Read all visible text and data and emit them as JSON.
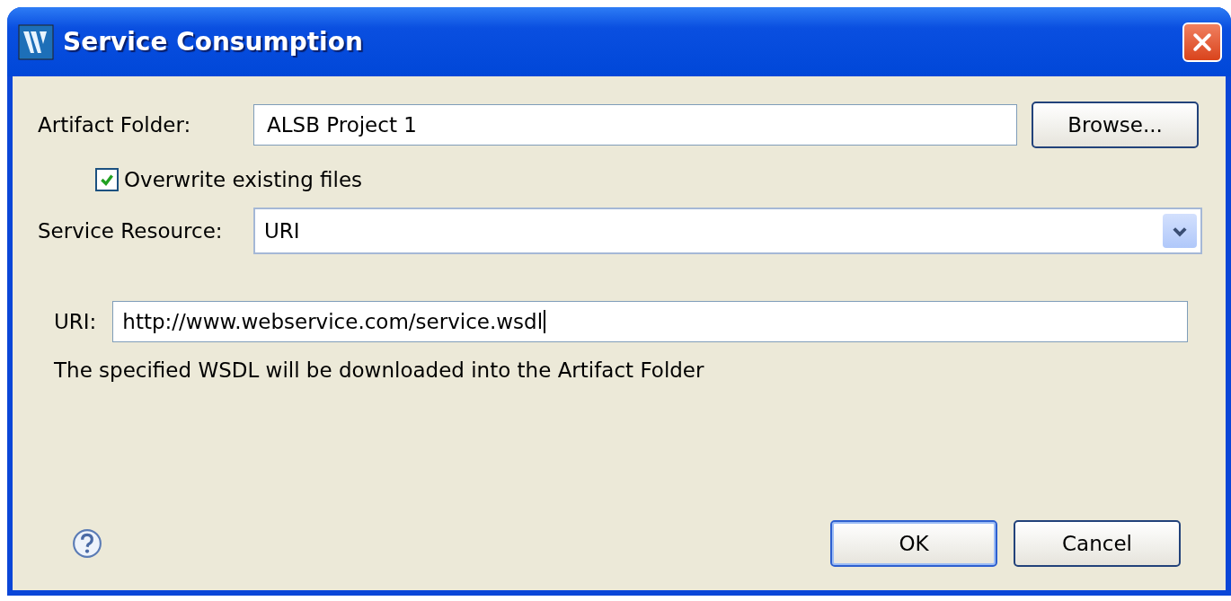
{
  "window": {
    "title": "Service Consumption"
  },
  "artifact_folder": {
    "label": "Artifact Folder:",
    "value": "ALSB Project 1",
    "button": "Browse..."
  },
  "overwrite": {
    "label": "Overwrite existing files",
    "checked": true
  },
  "service_resource": {
    "label": "Service Resource:",
    "value": "URI"
  },
  "uri": {
    "label": "URI:",
    "value": "http://www.webservice.com/service.wsdl"
  },
  "description": "The specified WSDL will be downloaded into the Artifact Folder",
  "buttons": [
    {
      "label": "OK",
      "default": true
    },
    {
      "label": "Cancel",
      "default": false
    }
  ]
}
